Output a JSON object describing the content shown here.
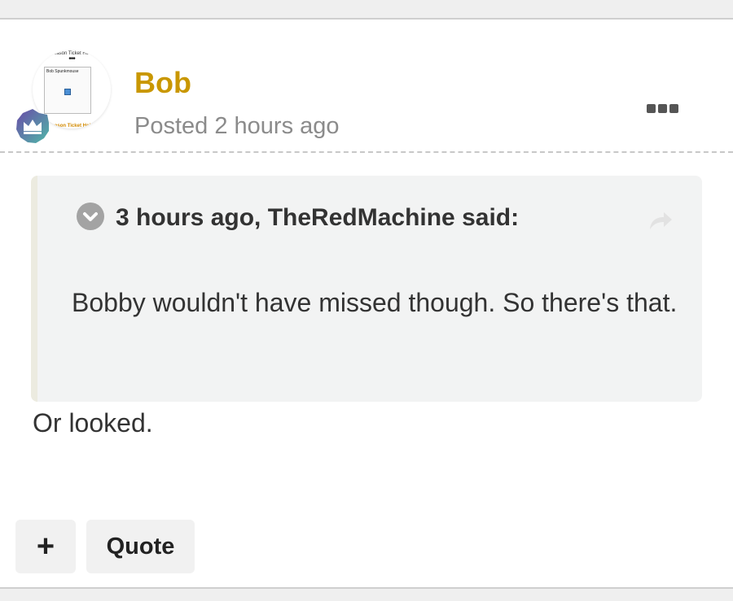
{
  "post": {
    "author": "Bob",
    "posted": "Posted 2 hours ago",
    "avatar": {
      "top_text": "Season Ticket Ho...",
      "dots": "•••",
      "inner_name": "Bob Spunkmouse",
      "bottom_text": "Season Ticket Hol..."
    },
    "badge_icon": "crown-icon",
    "more_icon": "ellipsis-icon",
    "quote": {
      "citation": "3 hours ago, TheRedMachine said:",
      "text": "Bobby wouldn't have missed though. So there's that.",
      "toggle_icon": "chevron-down-icon",
      "share_icon": "share-arrow-icon"
    },
    "body": "Or looked."
  },
  "actions": {
    "plus_label": "+",
    "quote_label": "Quote"
  },
  "colors": {
    "author": "#c99700",
    "meta": "#8b8b8b",
    "quote_bg": "#f2f3f3",
    "quote_border": "#ecebe0"
  }
}
